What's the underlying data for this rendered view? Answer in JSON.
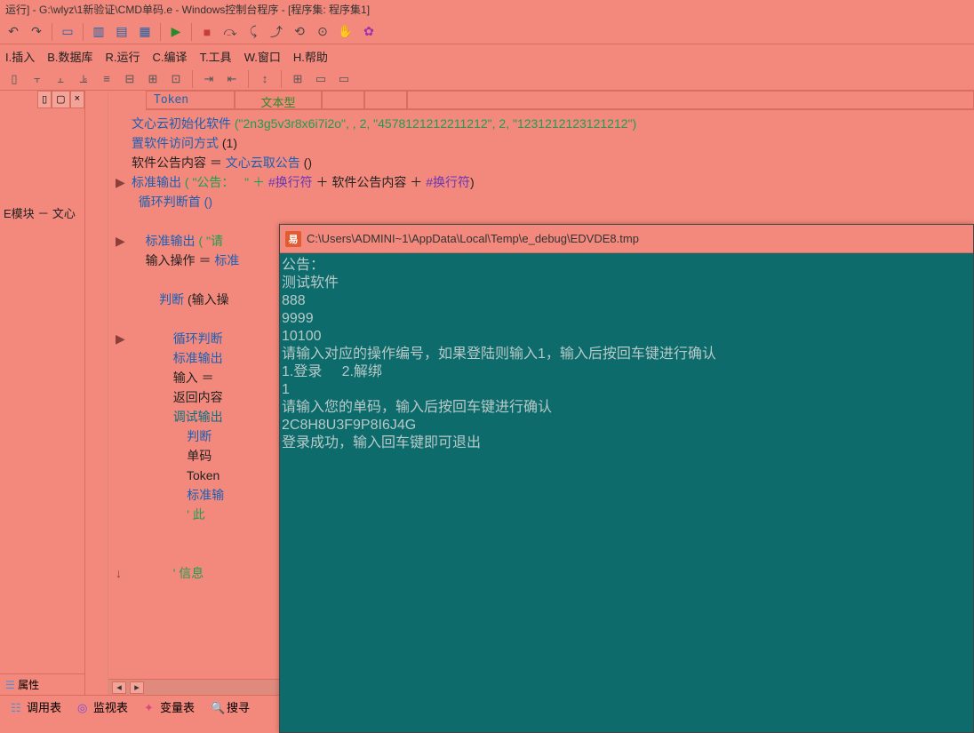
{
  "title": "运行] - G:\\wlyz\\1新验证\\CMD单码.e - Windows控制台程序 - [程序集: 程序集1]",
  "menu": {
    "i": "I.插入",
    "b": "B.数据库",
    "r": "R.运行",
    "c": "C.编译",
    "t": "T.工具",
    "w": "W.窗口",
    "h": "H.帮助"
  },
  "side": {
    "label": "E模块 － 文心",
    "prop_tab": "属性"
  },
  "table": {
    "col1": "Token",
    "col2": "文本型"
  },
  "code": {
    "l1a": "文心云初始化软件",
    "l1b": " (\"2n3g5v3r8x6i7i2o\", , 2, \"4578121212211212\", 2, \"1231212123121212\")",
    "l2a": "置软件访问方式",
    "l2b": " (1)",
    "l3a": "软件公告内容 ＝ ",
    "l3b": "文心云取公告",
    "l3c": " ()",
    "l4a": "标准输出",
    "l4b": " ( \"公告：   \" ＋ ",
    "l4c": "#换行符",
    "l4d": " ＋ 软件公告内容 ＋ ",
    "l4e": "#换行符",
    "l4f": ")",
    "l5": "循环判断首 ()",
    "l6a": "标准输出",
    "l6b": " ( \"请",
    "l7a": "输入操作 ＝ ",
    "l7b": "标准",
    "l8a": "判断",
    "l8b": " (输入操",
    "l9": "循环判断",
    "l10": "标准输出",
    "l11": "输入 ＝ ",
    "l12": "返回内容",
    "l13": "调试输出",
    "l14": "判断",
    "l15": "单码",
    "l16": "Token",
    "l17": "标准输",
    "l18": "' 此",
    "l19": "' 信息"
  },
  "console": {
    "title": "C:\\Users\\ADMINI~1\\AppData\\Local\\Temp\\e_debug\\EDVDE8.tmp",
    "l1": "公告：",
    "l2": "测试软件",
    "l3": "888",
    "l4": "9999",
    "l5": "10100",
    "l6": "请输入对应的操作编号，如果登陆则输入1，输入后按回车键进行确认",
    "l7": "1.登录     2.解绑",
    "l8": "1",
    "l9": "请输入您的单码，输入后按回车键进行确认",
    "l10": "2C8H8U3F9P8I6J4G",
    "l11": "登录成功，输入回车键即可退出"
  },
  "bottom": {
    "t1": "调用表",
    "t2": "监视表",
    "t3": "变量表",
    "t4": "搜寻"
  }
}
